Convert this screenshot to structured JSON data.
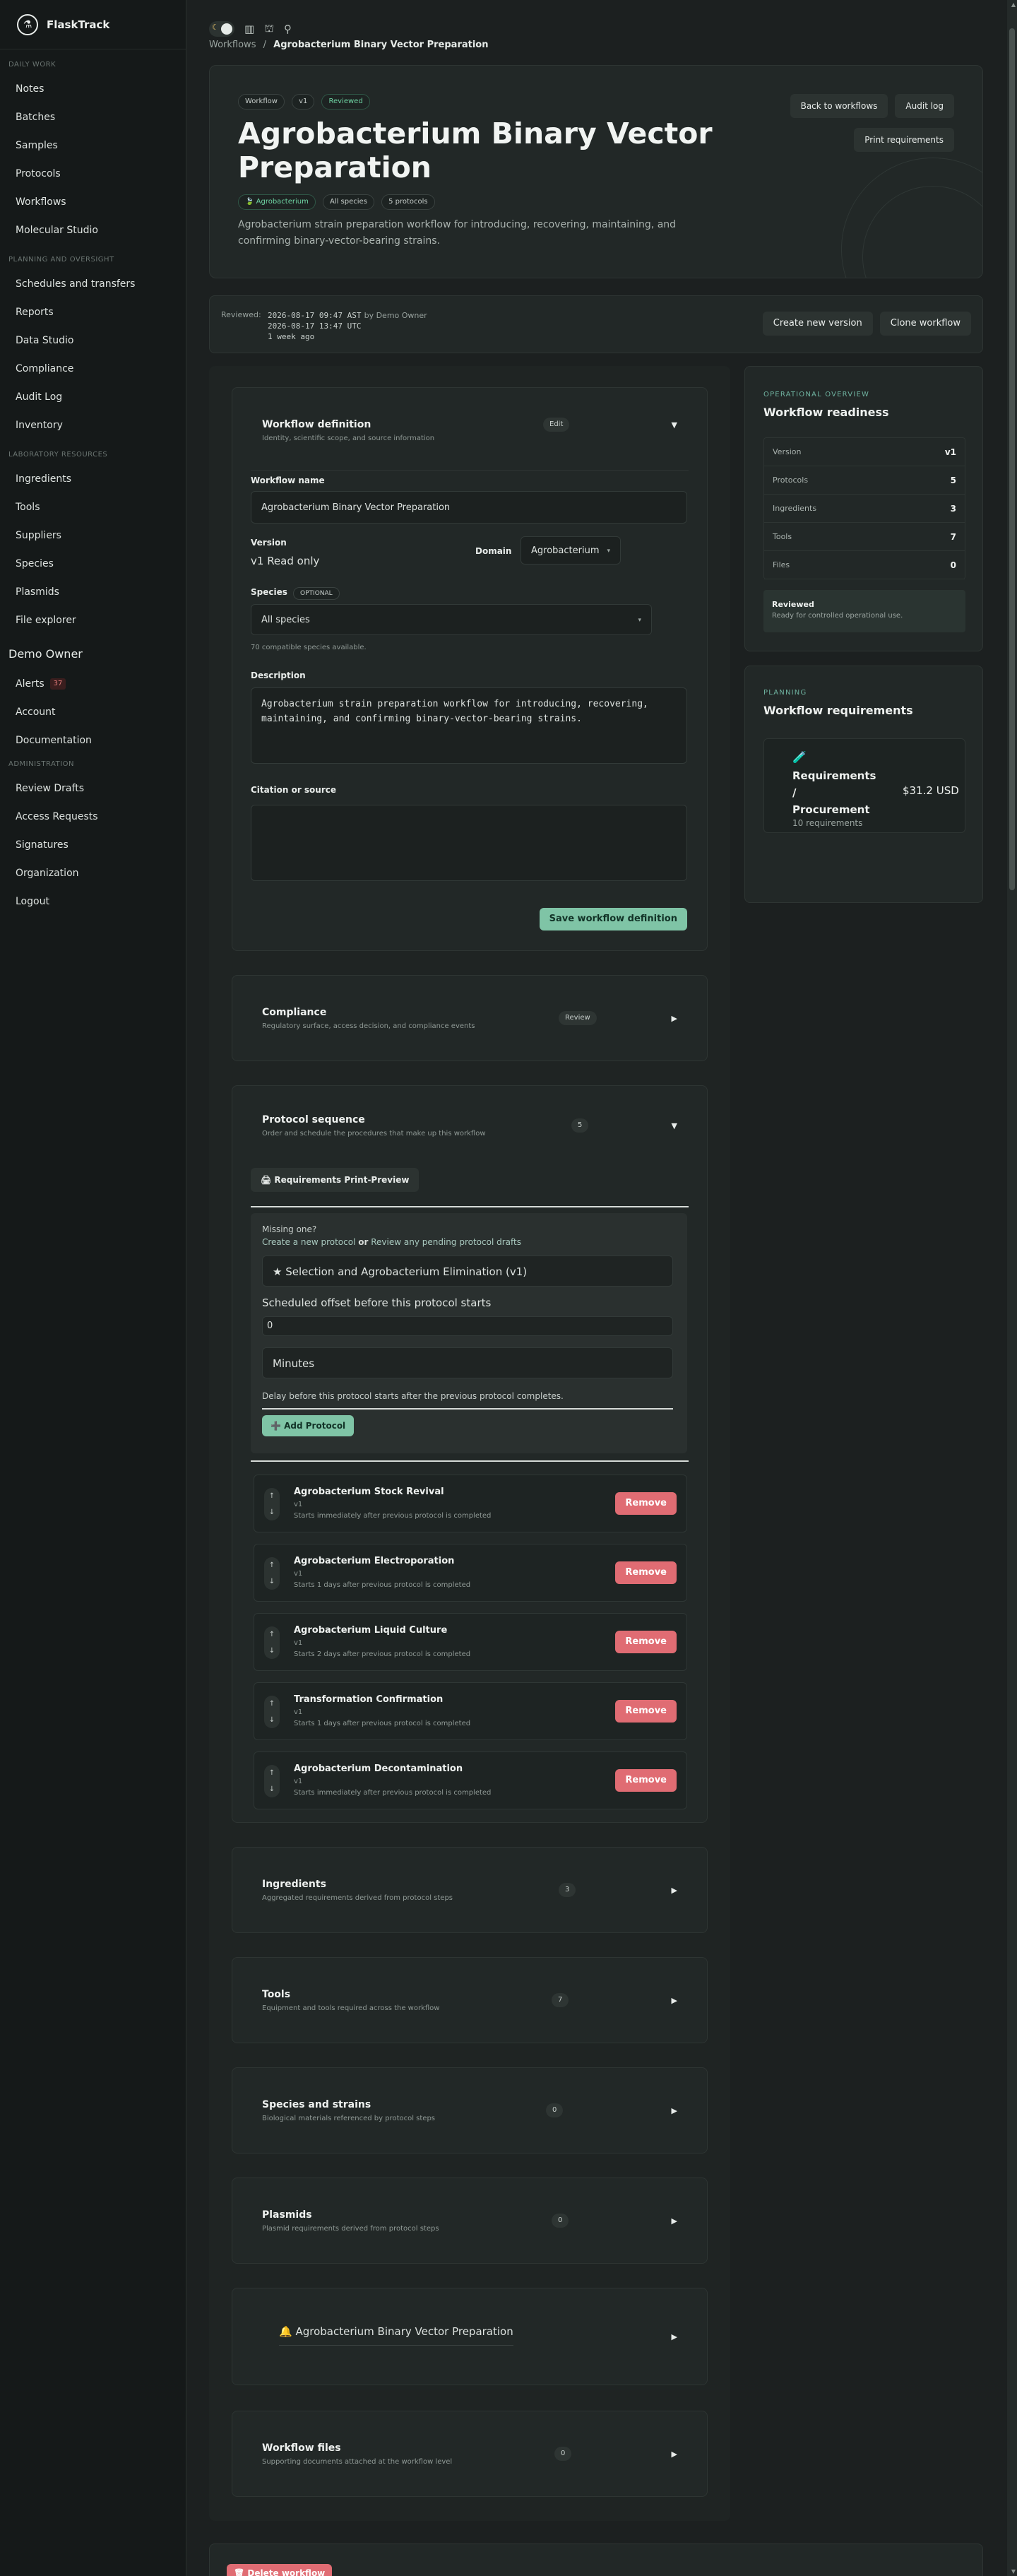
{
  "app": {
    "name": "FlaskTrack"
  },
  "sidebar": {
    "sections": [
      {
        "title": "DAILY WORK",
        "items": [
          "Notes",
          "Batches",
          "Samples",
          "Protocols",
          "Workflows",
          "Molecular Studio"
        ]
      },
      {
        "title": "PLANNING AND OVERSIGHT",
        "items": [
          "Schedules and transfers",
          "Reports",
          "Data Studio",
          "Compliance",
          "Audit Log",
          "Inventory"
        ]
      },
      {
        "title": "LABORATORY RESOURCES",
        "items": [
          "Ingredients",
          "Tools",
          "Suppliers",
          "Species",
          "Plasmids",
          "File explorer"
        ]
      }
    ],
    "user": "Demo Owner",
    "user_items": {
      "alerts": "Alerts",
      "alerts_badge": "37",
      "account": "Account",
      "documentation": "Documentation"
    },
    "admin": {
      "title": "ADMINISTRATION",
      "items": [
        "Review Drafts",
        "Access Requests",
        "Signatures",
        "Organization",
        "Logout"
      ]
    }
  },
  "breadcrumb": {
    "root": "Workflows",
    "sep": "/",
    "current": "Agrobacterium Binary Vector Preparation"
  },
  "hero": {
    "chips": [
      "Workflow",
      "v1",
      "Reviewed"
    ],
    "title": "Agrobacterium Binary Vector Preparation",
    "tags": [
      "🍃 Agrobacterium",
      "All species",
      "5 protocols"
    ],
    "description": "Agrobacterium strain preparation workflow for introducing, recovering, maintaining, and confirming binary-vector-bearing strains.",
    "actions": {
      "back": "Back to workflows",
      "audit": "Audit log",
      "print": "Print requirements"
    }
  },
  "review": {
    "label": "Reviewed:",
    "time1": "2026-08-17 09:47 AST",
    "by": "by Demo Owner",
    "time2": "2026-08-17 13:47 UTC",
    "ago": "1 week ago",
    "create_version": "Create new version",
    "clone": "Clone workflow"
  },
  "definition": {
    "title": "Workflow definition",
    "subtitle": "Identity, scientific scope, and source information",
    "edit": "Edit",
    "arrow": "▼",
    "name_label": "Workflow name",
    "name_value": "Agrobacterium Binary Vector Preparation",
    "version_label": "Version",
    "version_value": "v1 Read only",
    "domain_label": "Domain",
    "domain_value": "Agrobacterium",
    "species_label": "Species",
    "species_optional": "OPTIONAL",
    "species_value": "All species",
    "species_hint": "70 compatible species available.",
    "description_label": "Description",
    "description_value": "Agrobacterium strain preparation workflow for introducing, recovering, maintaining, and confirming binary-vector-bearing strains.",
    "citation_label": "Citation or source",
    "save": "Save workflow definition"
  },
  "compliance": {
    "title": "Compliance",
    "subtitle": "Regulatory surface, access decision, and compliance events",
    "badge": "Review",
    "arrow": "▶"
  },
  "sequence": {
    "title": "Protocol sequence",
    "subtitle": "Order and schedule the procedures that make up this workflow",
    "count": "5",
    "arrow": "▼",
    "print_preview": "🖨 Requirements Print-Preview",
    "missing": "Missing one?",
    "create_link": "Create a new protocol",
    "or": "or",
    "review_link": "Review any pending protocol drafts",
    "select_value": "★ Selection and Agrobacterium Elimination (v1)",
    "offset_label": "Scheduled offset before this protocol starts",
    "offset_value": "0",
    "unit_value": "Minutes",
    "delay_hint": "Delay before this protocol starts after the previous protocol completes.",
    "add": "➕ Add Protocol",
    "remove": "Remove",
    "protocols": [
      {
        "name": "Agrobacterium Stock Revival",
        "version": "v1",
        "note": "Starts immediately after previous protocol is completed"
      },
      {
        "name": "Agrobacterium Electroporation",
        "version": "v1",
        "note": "Starts 1 days after previous protocol is completed"
      },
      {
        "name": "Agrobacterium Liquid Culture",
        "version": "v1",
        "note": "Starts 2 days after previous protocol is completed"
      },
      {
        "name": "Transformation Confirmation",
        "version": "v1",
        "note": "Starts 1 days after previous protocol is completed"
      },
      {
        "name": "Agrobacterium Decontamination",
        "version": "v1",
        "note": "Starts immediately after previous protocol is completed"
      }
    ]
  },
  "ingredients": {
    "title": "Ingredients",
    "subtitle": "Aggregated requirements derived from protocol steps",
    "count": "3",
    "arrow": "▶"
  },
  "tools": {
    "title": "Tools",
    "subtitle": "Equipment and tools required across the workflow",
    "count": "7",
    "arrow": "▶"
  },
  "species": {
    "title": "Species and strains",
    "subtitle": "Biological materials referenced by protocol steps",
    "count": "0",
    "arrow": "▶"
  },
  "plasmids": {
    "title": "Plasmids",
    "subtitle": "Plasmid requirements derived from protocol steps",
    "count": "0",
    "arrow": "▶"
  },
  "preview": {
    "title": "🔔 Agrobacterium Binary Vector Preparation",
    "arrow": "▶"
  },
  "files": {
    "title": "Workflow files",
    "subtitle": "Supporting documents attached at the workflow level",
    "count": "0",
    "arrow": "▶"
  },
  "delete": "🗑 Delete workflow",
  "overview": {
    "eyebrow": "OPERATIONAL OVERVIEW",
    "title": "Workflow readiness",
    "stats": [
      {
        "label": "Version",
        "value": "v1"
      },
      {
        "label": "Protocols",
        "value": "5"
      },
      {
        "label": "Ingredients",
        "value": "3"
      },
      {
        "label": "Tools",
        "value": "7"
      },
      {
        "label": "Files",
        "value": "0"
      }
    ],
    "status_title": "Reviewed",
    "status_text": "Ready for controlled operational use."
  },
  "planning": {
    "eyebrow": "PLANNING",
    "title": "Workflow requirements",
    "icon": "🧪",
    "card_title": "Requirements / Procurement",
    "card_value": "$31.2 USD",
    "card_sub": "10 requirements"
  },
  "colors": {
    "accent": "#6fb3a0",
    "danger": "#e06c73",
    "save": "#7fc4a6"
  }
}
